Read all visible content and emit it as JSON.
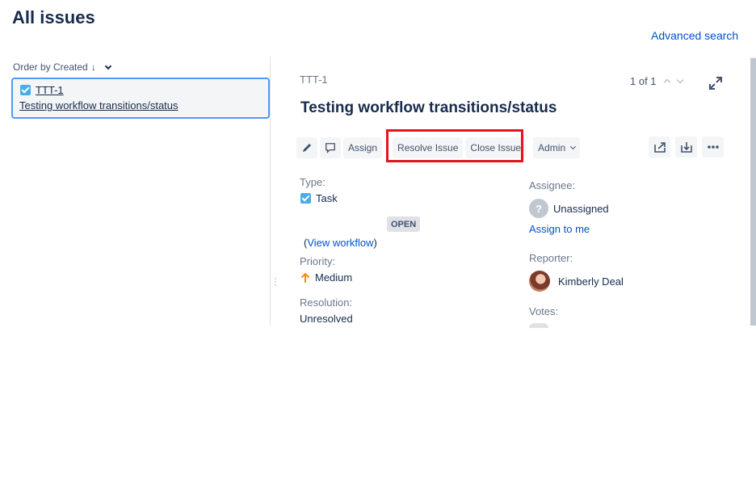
{
  "page": {
    "title": "All issues",
    "advanced_search": "Advanced search"
  },
  "list": {
    "order_label": "Order by Created",
    "issue": {
      "key": "TTT-1",
      "summary": "Testing workflow transitions/status"
    }
  },
  "detail": {
    "key": "TTT-1",
    "pager": "1 of 1",
    "title": "Testing workflow transitions/status",
    "toolbar": {
      "assign": "Assign",
      "resolve": "Resolve Issue",
      "close": "Close Issue",
      "admin": "Admin"
    },
    "fields": {
      "type_label": "Type:",
      "type_value": "Task",
      "status": "OPEN",
      "workflow_prefix": "(",
      "workflow_link": "View workflow",
      "workflow_suffix": ")",
      "priority_label": "Priority:",
      "priority_value": "Medium",
      "resolution_label": "Resolution:",
      "resolution_value": "Unresolved",
      "assignee_label": "Assignee:",
      "assignee_value": "Unassigned",
      "assign_to_me": "Assign to me",
      "reporter_label": "Reporter:",
      "reporter_value": "Kimberly Deal",
      "votes_label": "Votes:"
    }
  },
  "colors": {
    "link": "#0052cc",
    "highlight": "#e3141f",
    "task": "#4bade8",
    "priority_medium": "#ff8b00"
  },
  "icons": [
    "edit-icon",
    "comment-icon",
    "share-icon",
    "export-icon",
    "more-icon",
    "expand-icon",
    "sort-down-icon"
  ]
}
